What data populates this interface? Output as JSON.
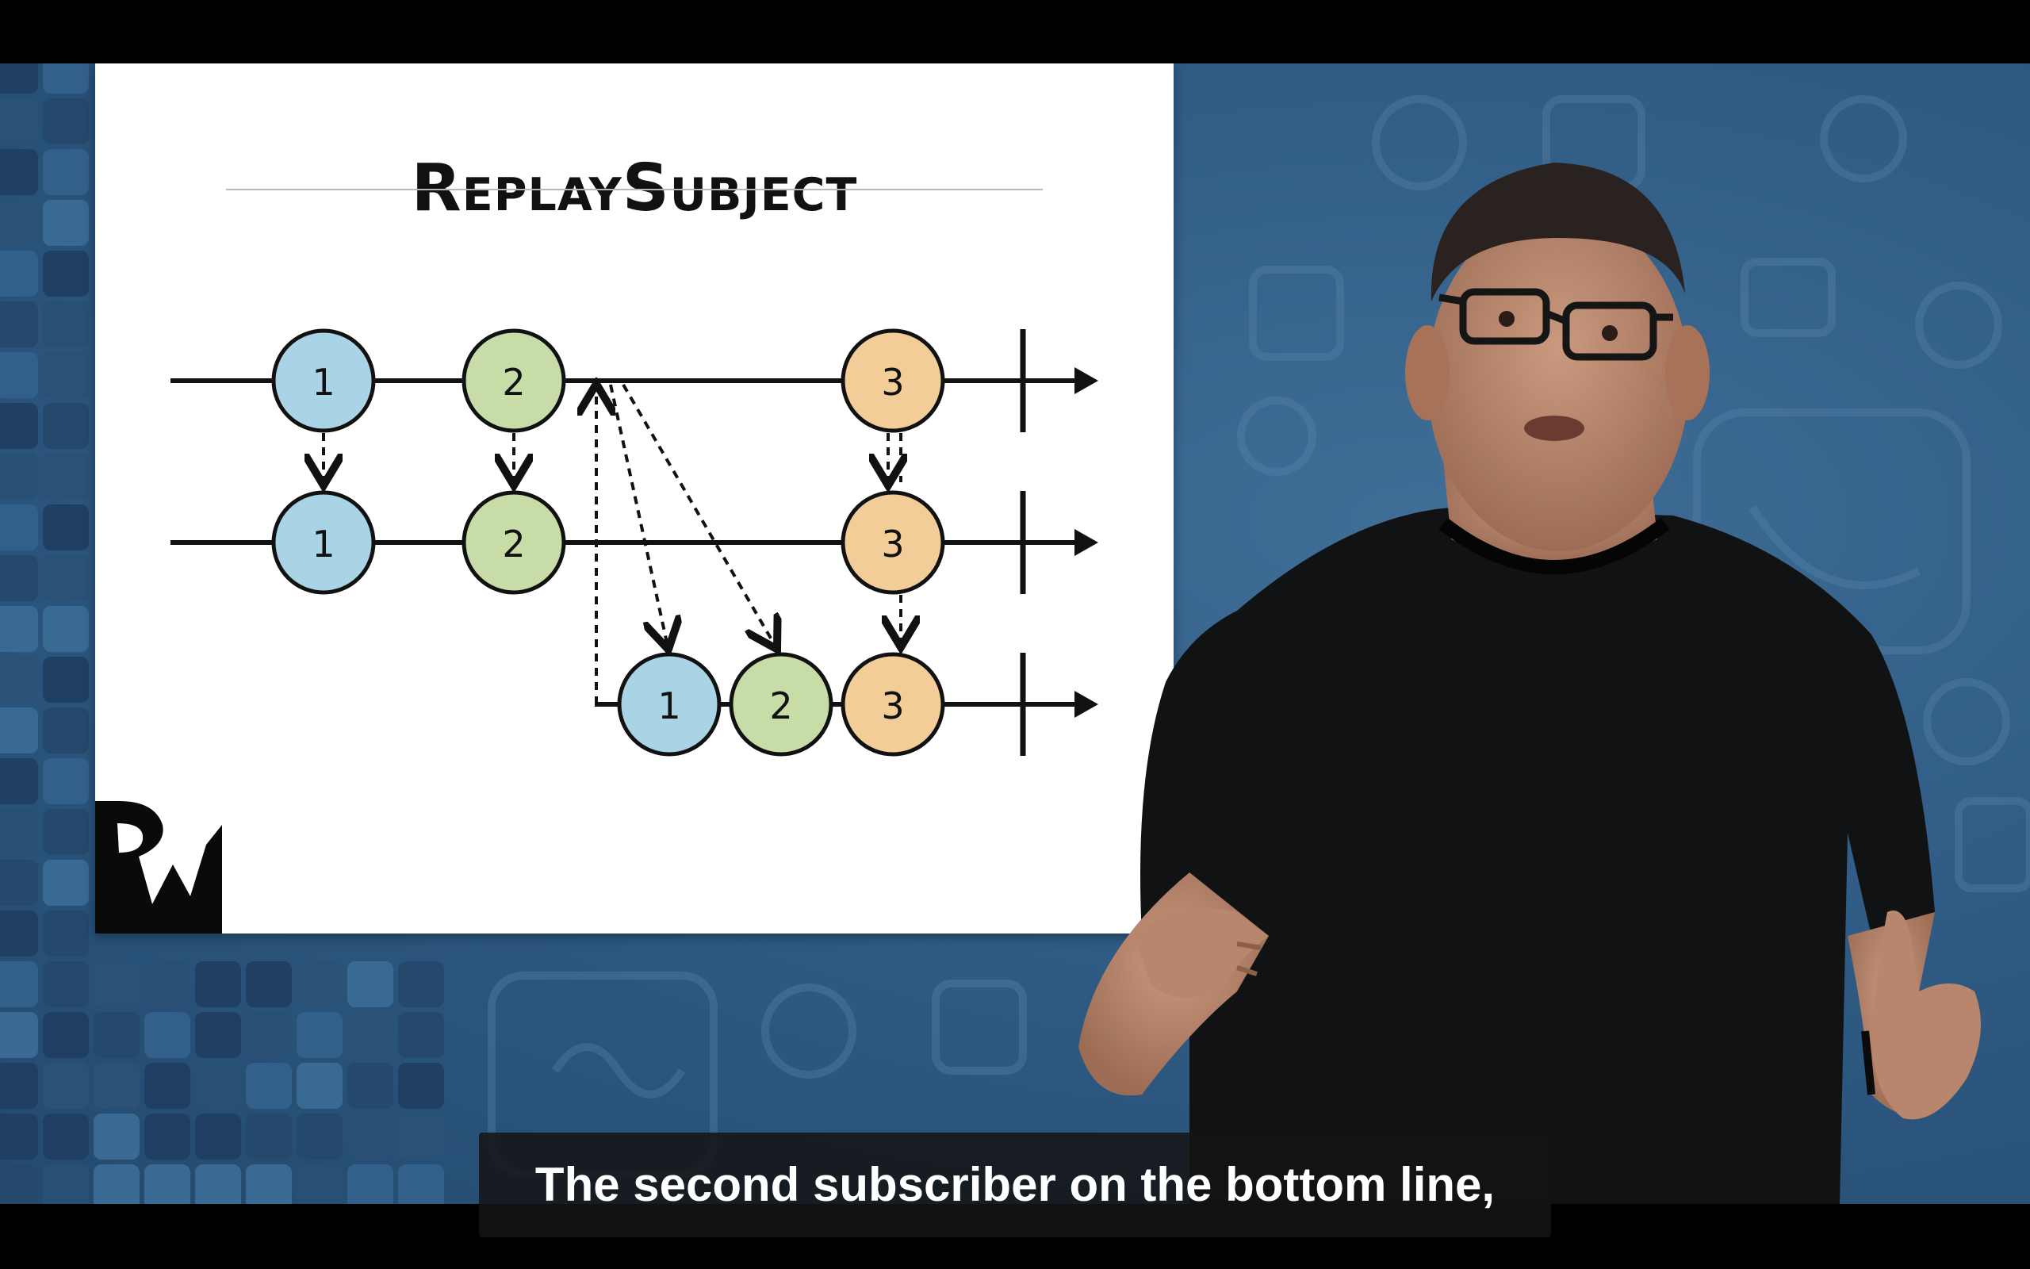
{
  "slide": {
    "title": "ReplaySubject",
    "logo_icon": "rw-logo-icon",
    "diagram": {
      "top_line_marbles": [
        "1",
        "2",
        "3"
      ],
      "middle_line_marbles": [
        "1",
        "2",
        "3"
      ],
      "bottom_line_marbles": [
        "1",
        "2",
        "3"
      ],
      "colors": {
        "marble_1": "#a9d4e6",
        "marble_2": "#c8dca8",
        "marble_3": "#f3cd97",
        "line": "#111111"
      }
    }
  },
  "caption": {
    "text": "The second subscriber on the bottom line,"
  },
  "colors": {
    "background": "#305c85",
    "caption_bg": "#141414",
    "slide_bg": "#ffffff"
  }
}
